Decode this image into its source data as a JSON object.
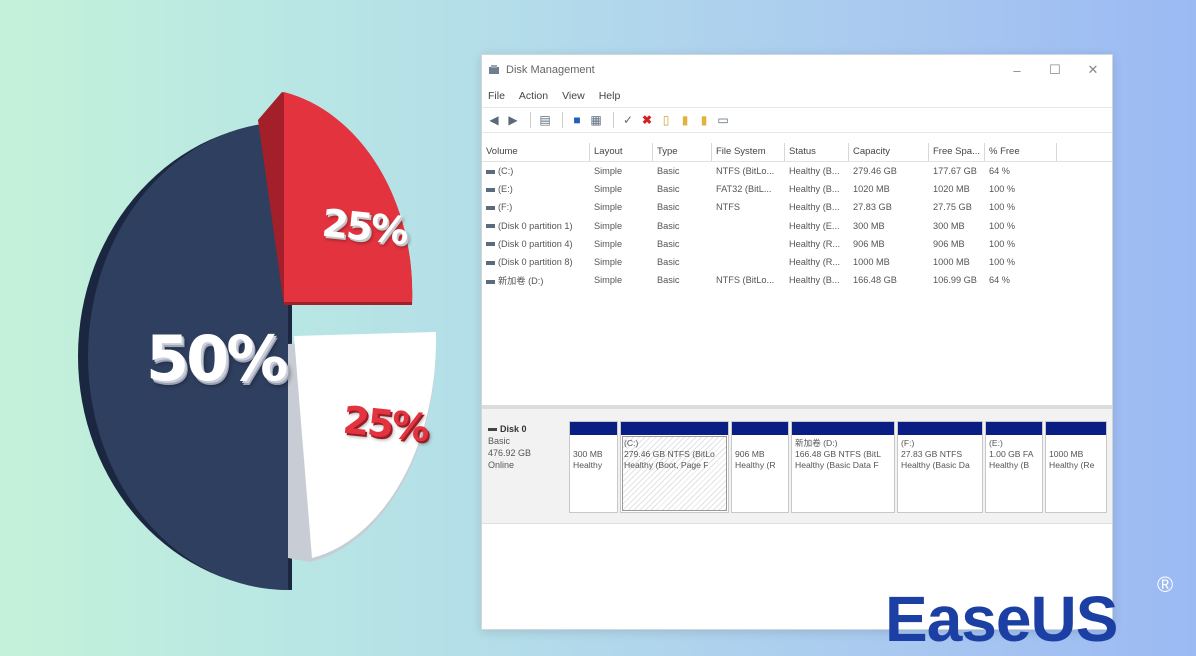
{
  "pie": {
    "label_large": "50%",
    "label_red": "25%",
    "label_white": "25%",
    "colors": {
      "navy": "#2f3f5f",
      "red": "#e2333f",
      "white": "#ffffff"
    }
  },
  "window": {
    "title": "Disk Management",
    "min": "–",
    "max": "☐",
    "close": "✕",
    "menu": [
      "File",
      "Action",
      "View",
      "Help"
    ],
    "columns": [
      "Volume",
      "Layout",
      "Type",
      "File System",
      "Status",
      "Capacity",
      "Free Spa...",
      "% Free"
    ],
    "rows": [
      [
        "(C:)",
        "Simple",
        "Basic",
        "NTFS (BitLo...",
        "Healthy (B...",
        "279.46 GB",
        "177.67 GB",
        "64 %"
      ],
      [
        "(E:)",
        "Simple",
        "Basic",
        "FAT32 (BitL...",
        "Healthy (B...",
        "1020 MB",
        "1020 MB",
        "100 %"
      ],
      [
        "(F:)",
        "Simple",
        "Basic",
        "NTFS",
        "Healthy (B...",
        "27.83 GB",
        "27.75 GB",
        "100 %"
      ],
      [
        "(Disk 0 partition 1)",
        "Simple",
        "Basic",
        "",
        "Healthy (E...",
        "300 MB",
        "300 MB",
        "100 %"
      ],
      [
        "(Disk 0 partition 4)",
        "Simple",
        "Basic",
        "",
        "Healthy (R...",
        "906 MB",
        "906 MB",
        "100 %"
      ],
      [
        "(Disk 0 partition 8)",
        "Simple",
        "Basic",
        "",
        "Healthy (R...",
        "1000 MB",
        "1000 MB",
        "100 %"
      ],
      [
        "新加卷 (D:)",
        "Simple",
        "Basic",
        "NTFS (BitLo...",
        "Healthy (B...",
        "166.48 GB",
        "106.99 GB",
        "64 %"
      ]
    ],
    "disk": {
      "name": "Disk 0",
      "type": "Basic",
      "size": "476.92 GB",
      "state": "Online",
      "partitions": [
        {
          "title": "",
          "line1": "300 MB",
          "line2": "Healthy"
        },
        {
          "title": "(C:)",
          "line1": "279.46 GB NTFS (BitLo",
          "line2": "Healthy (Boot, Page F"
        },
        {
          "title": "",
          "line1": "906 MB",
          "line2": "Healthy (R"
        },
        {
          "title": "新加卷 (D:)",
          "line1": "166.48 GB NTFS (BitL",
          "line2": "Healthy (Basic Data F"
        },
        {
          "title": "(F:)",
          "line1": "27.83 GB NTFS",
          "line2": "Healthy (Basic Da"
        },
        {
          "title": "(E:)",
          "line1": "1.00 GB FA",
          "line2": "Healthy (B"
        },
        {
          "title": "",
          "line1": "1000 MB",
          "line2": "Healthy (Re"
        }
      ]
    }
  },
  "logo": {
    "text": "EaseUS",
    "reg": "®"
  }
}
